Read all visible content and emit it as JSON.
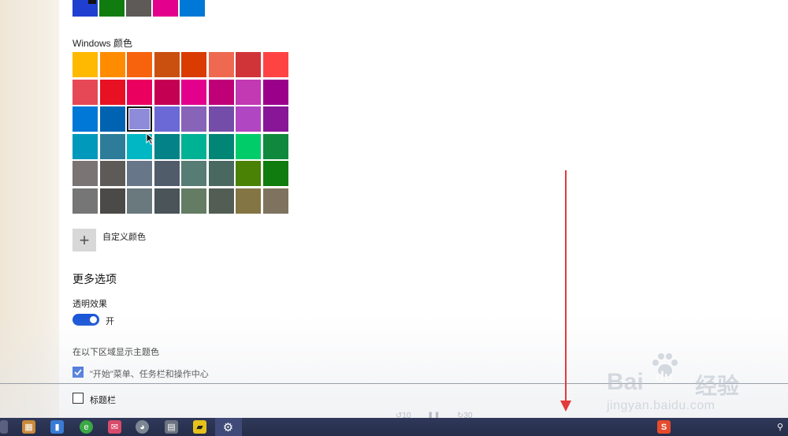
{
  "recent_colors": [
    "#1f3fd1",
    "#107c10",
    "#5d5a58",
    "#e3008c",
    "#0078d7"
  ],
  "windows_colors": {
    "label": "Windows 颜色",
    "rows": [
      [
        "#ffb900",
        "#ff8c00",
        "#f7630c",
        "#ca5010",
        "#da3b01",
        "#ef6950",
        "#d13438",
        "#ff4343"
      ],
      [
        "#e74856",
        "#e81123",
        "#ea005e",
        "#c30052",
        "#e3008c",
        "#bf0077",
        "#c239b3",
        "#9a0089"
      ],
      [
        "#0078d7",
        "#0063b1",
        "#8e8cd8",
        "#6b69d6",
        "#8764b8",
        "#744da9",
        "#b146c2",
        "#881798"
      ],
      [
        "#0099bc",
        "#2d7d9a",
        "#00b7c3",
        "#038387",
        "#00b294",
        "#018574",
        "#00cc6a",
        "#10893e"
      ],
      [
        "#7a7574",
        "#5d5a58",
        "#68768a",
        "#515c6b",
        "#567c73",
        "#486860",
        "#498205",
        "#107c10"
      ],
      [
        "#767676",
        "#4c4a48",
        "#69797e",
        "#4a5459",
        "#647c64",
        "#525e54",
        "#847545",
        "#7e735f"
      ]
    ],
    "selected": [
      2,
      2
    ]
  },
  "custom_color": {
    "label": "自定义颜色",
    "icon": "plus-icon"
  },
  "more_options": {
    "title": "更多选项",
    "transparency": {
      "label": "透明效果",
      "state": "开",
      "on": true
    },
    "accent_surfaces": {
      "label": "在以下区域显示主题色",
      "start_taskbar": {
        "label": "\"开始\"菜单、任务栏和操作中心",
        "checked": true
      },
      "title_bars": {
        "label": "标题栏",
        "checked": false
      }
    }
  },
  "taskbar": {
    "icons": [
      "media-icon",
      "apps-icon",
      "book-icon",
      "browser-icon",
      "mail-icon",
      "cat-icon",
      "calculator-icon",
      "sticky-notes-icon",
      "settings-icon"
    ],
    "tray": {
      "ime": "S"
    }
  },
  "player": {
    "rewind": "10",
    "forward": "30"
  },
  "watermark": {
    "brand": "Bai",
    "brand2": "du",
    "cn": "经验",
    "url": "jingyan.baidu.com"
  },
  "colors": {
    "accent": "#1a56d6",
    "annotation": "#e23b3b",
    "taskbar": "#2a3352"
  }
}
